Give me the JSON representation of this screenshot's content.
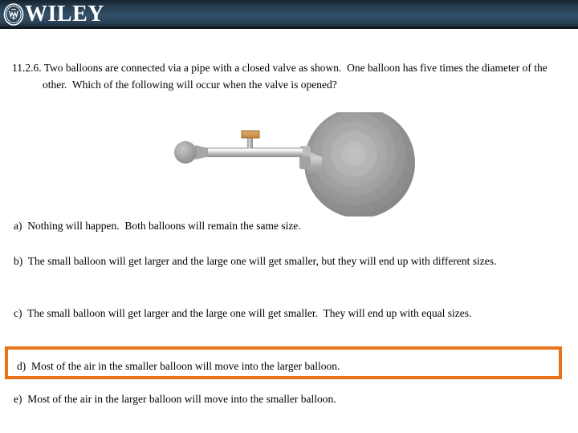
{
  "header": {
    "brand_name": "WILEY",
    "emblem_icon": "wiley-crest-icon",
    "background_color": "#32506a",
    "text_color": "#ffffff"
  },
  "question": {
    "number": "11.2.6.",
    "text": "11.2.6. Two balloons are connected via a pipe with a closed valve as shown.  One balloon has five times the diameter of the other.  Which of the following will occur when the valve is opened?"
  },
  "diagram": {
    "name": "two-balloons-connected-by-valved-pipe",
    "small_balloon_label": "small-balloon",
    "large_balloon_label": "large-balloon",
    "pipe_label": "connecting-pipe",
    "valve_label": "closed-valve-handle",
    "balloon_color_center": "#bdbdbd",
    "balloon_color_edge": "#8a8a8a",
    "pipe_color": "#b7b7b7",
    "valve_color": "#d79a5b"
  },
  "options": [
    {
      "id": "a",
      "text": "a)  Nothing will happen.  Both balloons will remain the same size.",
      "highlighted": false
    },
    {
      "id": "b",
      "text": "b)  The small balloon will get larger and the large one will get smaller, but they will end up with different sizes.",
      "highlighted": false
    },
    {
      "id": "c",
      "text": "c)  The small balloon will get larger and the large one will get smaller.  They will end up with equal sizes.",
      "highlighted": false
    },
    {
      "id": "d",
      "text": "d)  Most of the air in the smaller balloon will move into the larger balloon.",
      "highlighted": true
    },
    {
      "id": "e",
      "text": "e)  Most of the air in the larger balloon will move into the smaller balloon.",
      "highlighted": false
    }
  ],
  "highlight": {
    "border_color": "#e8731a"
  }
}
